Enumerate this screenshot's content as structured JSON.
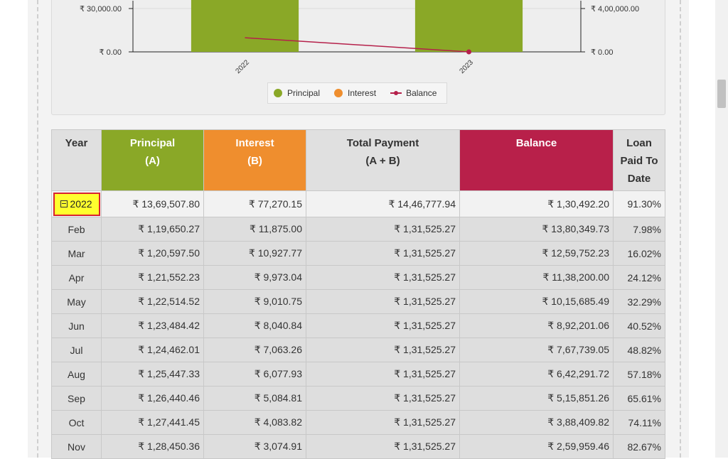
{
  "colors": {
    "principal": "#8aa827",
    "interest": "#ef8e2e",
    "balance": "#b8204a"
  },
  "chart_data": {
    "type": "bar",
    "categories": [
      "2022",
      "2023"
    ],
    "left_axis": {
      "ticks": [
        "₹ 0.00",
        "₹ 30,000.00"
      ],
      "values": [
        0,
        30000
      ]
    },
    "right_axis": {
      "ticks": [
        "₹ 0.00",
        "₹ 4,00,000.00"
      ],
      "values": [
        0,
        400000
      ]
    },
    "series": [
      {
        "name": "Principal",
        "axis": "left",
        "values": [
          1369507.8,
          130492.2
        ]
      },
      {
        "name": "Interest",
        "axis": "left",
        "values": [
          77270.15,
          0
        ]
      },
      {
        "name": "Balance",
        "axis": "right",
        "type": "line",
        "values": [
          130492.2,
          0
        ]
      }
    ],
    "legend": [
      {
        "label": "Principal",
        "symbol": "dot"
      },
      {
        "label": "Interest",
        "symbol": "dot"
      },
      {
        "label": "Balance",
        "symbol": "line"
      }
    ],
    "legend_position": "bottom"
  },
  "table": {
    "headers": {
      "year": "Year",
      "principal": [
        "Principal",
        "(A)"
      ],
      "interest": [
        "Interest",
        "(B)"
      ],
      "total": [
        "Total Payment",
        "(A + B)"
      ],
      "balance": "Balance",
      "loan": [
        "Loan",
        "Paid To",
        "Date"
      ]
    },
    "year_row": {
      "year": "2022",
      "principal": "₹ 13,69,507.80",
      "interest": "₹ 77,270.15",
      "total": "₹ 14,46,777.94",
      "balance": "₹ 1,30,492.20",
      "loan": "91.30%"
    },
    "rows": [
      {
        "month": "Feb",
        "principal": "₹ 1,19,650.27",
        "interest": "₹ 11,875.00",
        "total": "₹ 1,31,525.27",
        "balance": "₹ 13,80,349.73",
        "loan": "7.98%"
      },
      {
        "month": "Mar",
        "principal": "₹ 1,20,597.50",
        "interest": "₹ 10,927.77",
        "total": "₹ 1,31,525.27",
        "balance": "₹ 12,59,752.23",
        "loan": "16.02%"
      },
      {
        "month": "Apr",
        "principal": "₹ 1,21,552.23",
        "interest": "₹ 9,973.04",
        "total": "₹ 1,31,525.27",
        "balance": "₹ 11,38,200.00",
        "loan": "24.12%"
      },
      {
        "month": "May",
        "principal": "₹ 1,22,514.52",
        "interest": "₹ 9,010.75",
        "total": "₹ 1,31,525.27",
        "balance": "₹ 10,15,685.49",
        "loan": "32.29%"
      },
      {
        "month": "Jun",
        "principal": "₹ 1,23,484.42",
        "interest": "₹ 8,040.84",
        "total": "₹ 1,31,525.27",
        "balance": "₹ 8,92,201.06",
        "loan": "40.52%"
      },
      {
        "month": "Jul",
        "principal": "₹ 1,24,462.01",
        "interest": "₹ 7,063.26",
        "total": "₹ 1,31,525.27",
        "balance": "₹ 7,67,739.05",
        "loan": "48.82%"
      },
      {
        "month": "Aug",
        "principal": "₹ 1,25,447.33",
        "interest": "₹ 6,077.93",
        "total": "₹ 1,31,525.27",
        "balance": "₹ 6,42,291.72",
        "loan": "57.18%"
      },
      {
        "month": "Sep",
        "principal": "₹ 1,26,440.46",
        "interest": "₹ 5,084.81",
        "total": "₹ 1,31,525.27",
        "balance": "₹ 5,15,851.26",
        "loan": "65.61%"
      },
      {
        "month": "Oct",
        "principal": "₹ 1,27,441.45",
        "interest": "₹ 4,083.82",
        "total": "₹ 1,31,525.27",
        "balance": "₹ 3,88,409.82",
        "loan": "74.11%"
      },
      {
        "month": "Nov",
        "principal": "₹ 1,28,450.36",
        "interest": "₹ 3,074.91",
        "total": "₹ 1,31,525.27",
        "balance": "₹ 2,59,959.46",
        "loan": "82.67%"
      }
    ]
  }
}
